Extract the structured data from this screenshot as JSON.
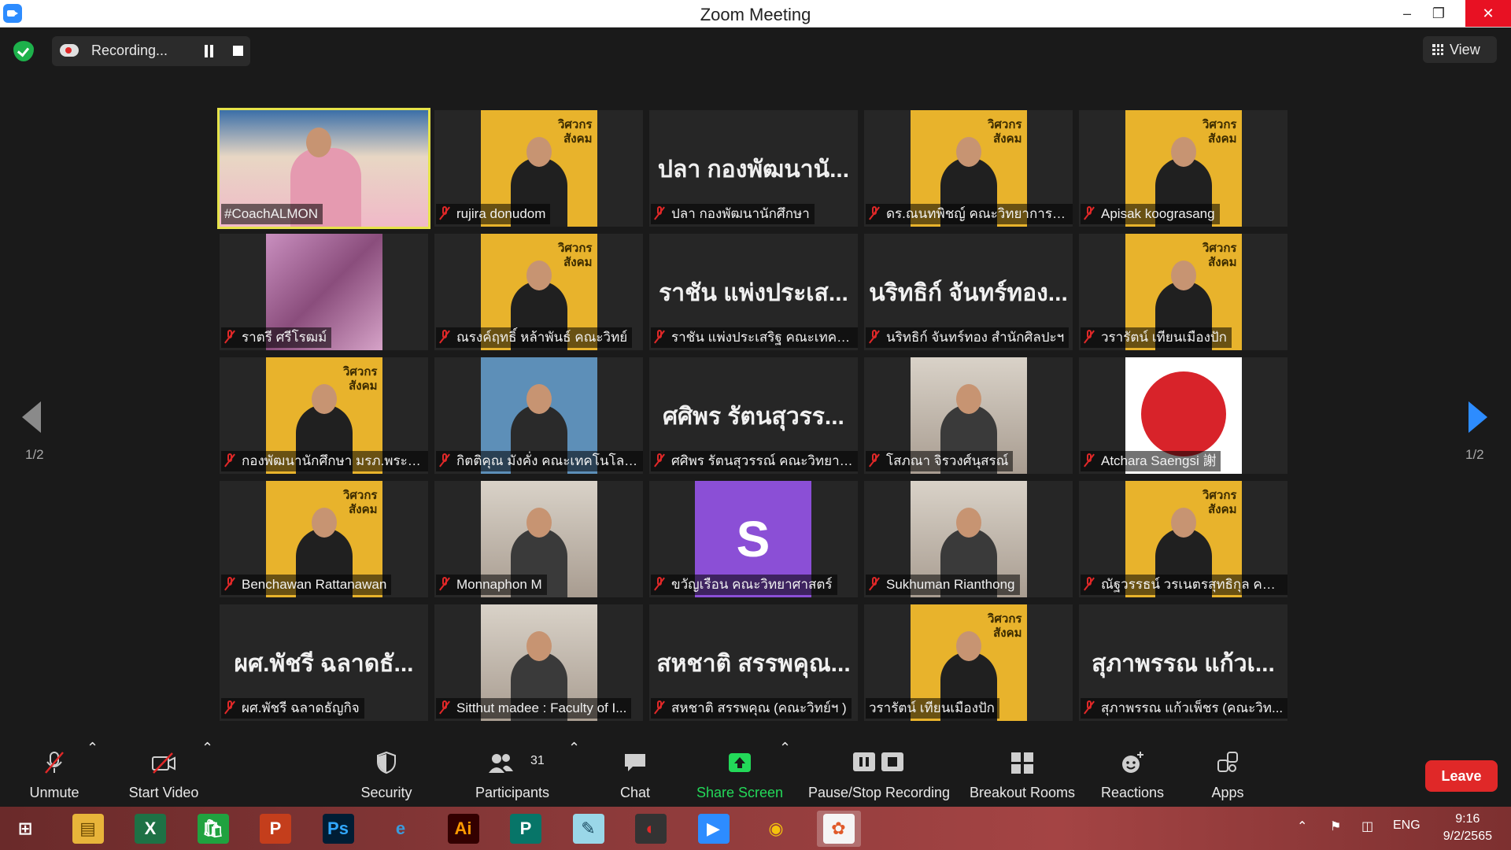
{
  "window": {
    "title": "Zoom Meeting"
  },
  "recording": {
    "label": "Recording...",
    "pause_icon": "pause-icon",
    "stop_icon": "stop-icon"
  },
  "view": {
    "label": "View"
  },
  "pagination": {
    "left": "1/2",
    "right": "1/2"
  },
  "tiles": [
    {
      "name": "#CoachALMON",
      "muted": false,
      "active": true,
      "display": "video"
    },
    {
      "name": "rujira donudom",
      "muted": true,
      "display": "poster"
    },
    {
      "name": "ปลา กองพัฒนานักศึกษา",
      "muted": true,
      "display": "text",
      "big": "ปลา กองพัฒนานั..."
    },
    {
      "name": "ดร.ณนทพิชญ์ คณะวิทยาการจัด...",
      "muted": true,
      "display": "poster"
    },
    {
      "name": "Apisak koograsang",
      "muted": true,
      "display": "poster"
    },
    {
      "name": "ราตรี ศรีโรฒม์",
      "muted": true,
      "display": "fabric"
    },
    {
      "name": "ณรงค์ฤทธิ์ หล้าพันธ์ คณะวิทย์",
      "muted": true,
      "display": "poster"
    },
    {
      "name": "ราชัน แพ่งประเสริฐ คณะเทคโนโ...",
      "muted": true,
      "display": "text",
      "big": "ราชัน แพ่งประเส..."
    },
    {
      "name": "นริทธิก์ จันทร์ทอง สำนักศิลปะฯ",
      "muted": true,
      "display": "text",
      "big": "นริทธิก์ จันทร์ทอง..."
    },
    {
      "name": "วรารัตน์ เทียนเมืองปัก",
      "muted": true,
      "display": "poster"
    },
    {
      "name": "กองพัฒนานักศึกษา มรภ.พระนคร",
      "muted": true,
      "display": "poster"
    },
    {
      "name": "กิตติคุณ มังคั่ง คณะเทคโนโลยีอุ...",
      "muted": true,
      "display": "portrait"
    },
    {
      "name": "ศศิพร รัตนสุวรรณ์ คณะวิทยาศ...",
      "muted": true,
      "display": "text",
      "big": "ศศิพร รัตนสุวรร..."
    },
    {
      "name": "โสภณา จิรวงศ์นุสรณ์",
      "muted": true,
      "display": "photo"
    },
    {
      "name": "Atchara Saengsi 謝",
      "muted": true,
      "display": "bird"
    },
    {
      "name": "Benchawan Rattanawan",
      "muted": true,
      "display": "poster"
    },
    {
      "name": "Monnaphon M",
      "muted": true,
      "display": "photo"
    },
    {
      "name": "ขวัญเรือน คณะวิทยาศาสตร์",
      "muted": true,
      "display": "avatar",
      "letter": "S"
    },
    {
      "name": "Sukhuman Rianthong",
      "muted": true,
      "display": "photo"
    },
    {
      "name": "ณัฐวรรธน์ วรเนตรสุทธิกุล คณะเ...",
      "muted": true,
      "display": "poster"
    },
    {
      "name": "ผศ.พัชรี ฉลาดธัญกิจ",
      "muted": true,
      "display": "text",
      "big": "ผศ.พัชรี ฉลาดธั..."
    },
    {
      "name": "Sitthut madee : Faculty of I...",
      "muted": true,
      "display": "photo"
    },
    {
      "name": "สหชาติ สรรพคุณ (คณะวิทย์ฯ )",
      "muted": true,
      "display": "text",
      "big": "สหชาติ สรรพคุณ..."
    },
    {
      "name": "วรารัตน์ เทียนเมืองปัก",
      "muted": false,
      "display": "poster"
    },
    {
      "name": "สุภาพรรณ แก้วเพ็ชร (คณะวิท...",
      "muted": true,
      "display": "text",
      "big": "สุภาพรรณ แก้วเ..."
    }
  ],
  "toolbar": {
    "unmute": "Unmute",
    "start_video": "Start Video",
    "security": "Security",
    "participants": "Participants",
    "participants_count": "31",
    "chat": "Chat",
    "share_screen": "Share Screen",
    "pause_stop_recording": "Pause/Stop Recording",
    "breakout_rooms": "Breakout Rooms",
    "reactions": "Reactions",
    "apps": "Apps",
    "leave": "Leave"
  },
  "taskbar": {
    "apps": [
      "Start",
      "File Explorer",
      "Excel",
      "Store",
      "PowerPoint",
      "Photoshop",
      "Internet Explorer",
      "Illustrator",
      "Publisher",
      "Notepad",
      "PhotoScape",
      "Zoom",
      "Chrome",
      "Photos"
    ],
    "language": "ENG",
    "time": "9:16",
    "date": "9/2/2565"
  },
  "colors": {
    "accent": "#2d8cff",
    "leave": "#e02828",
    "active_border": "#e6e34a",
    "share_green": "#23d959"
  }
}
